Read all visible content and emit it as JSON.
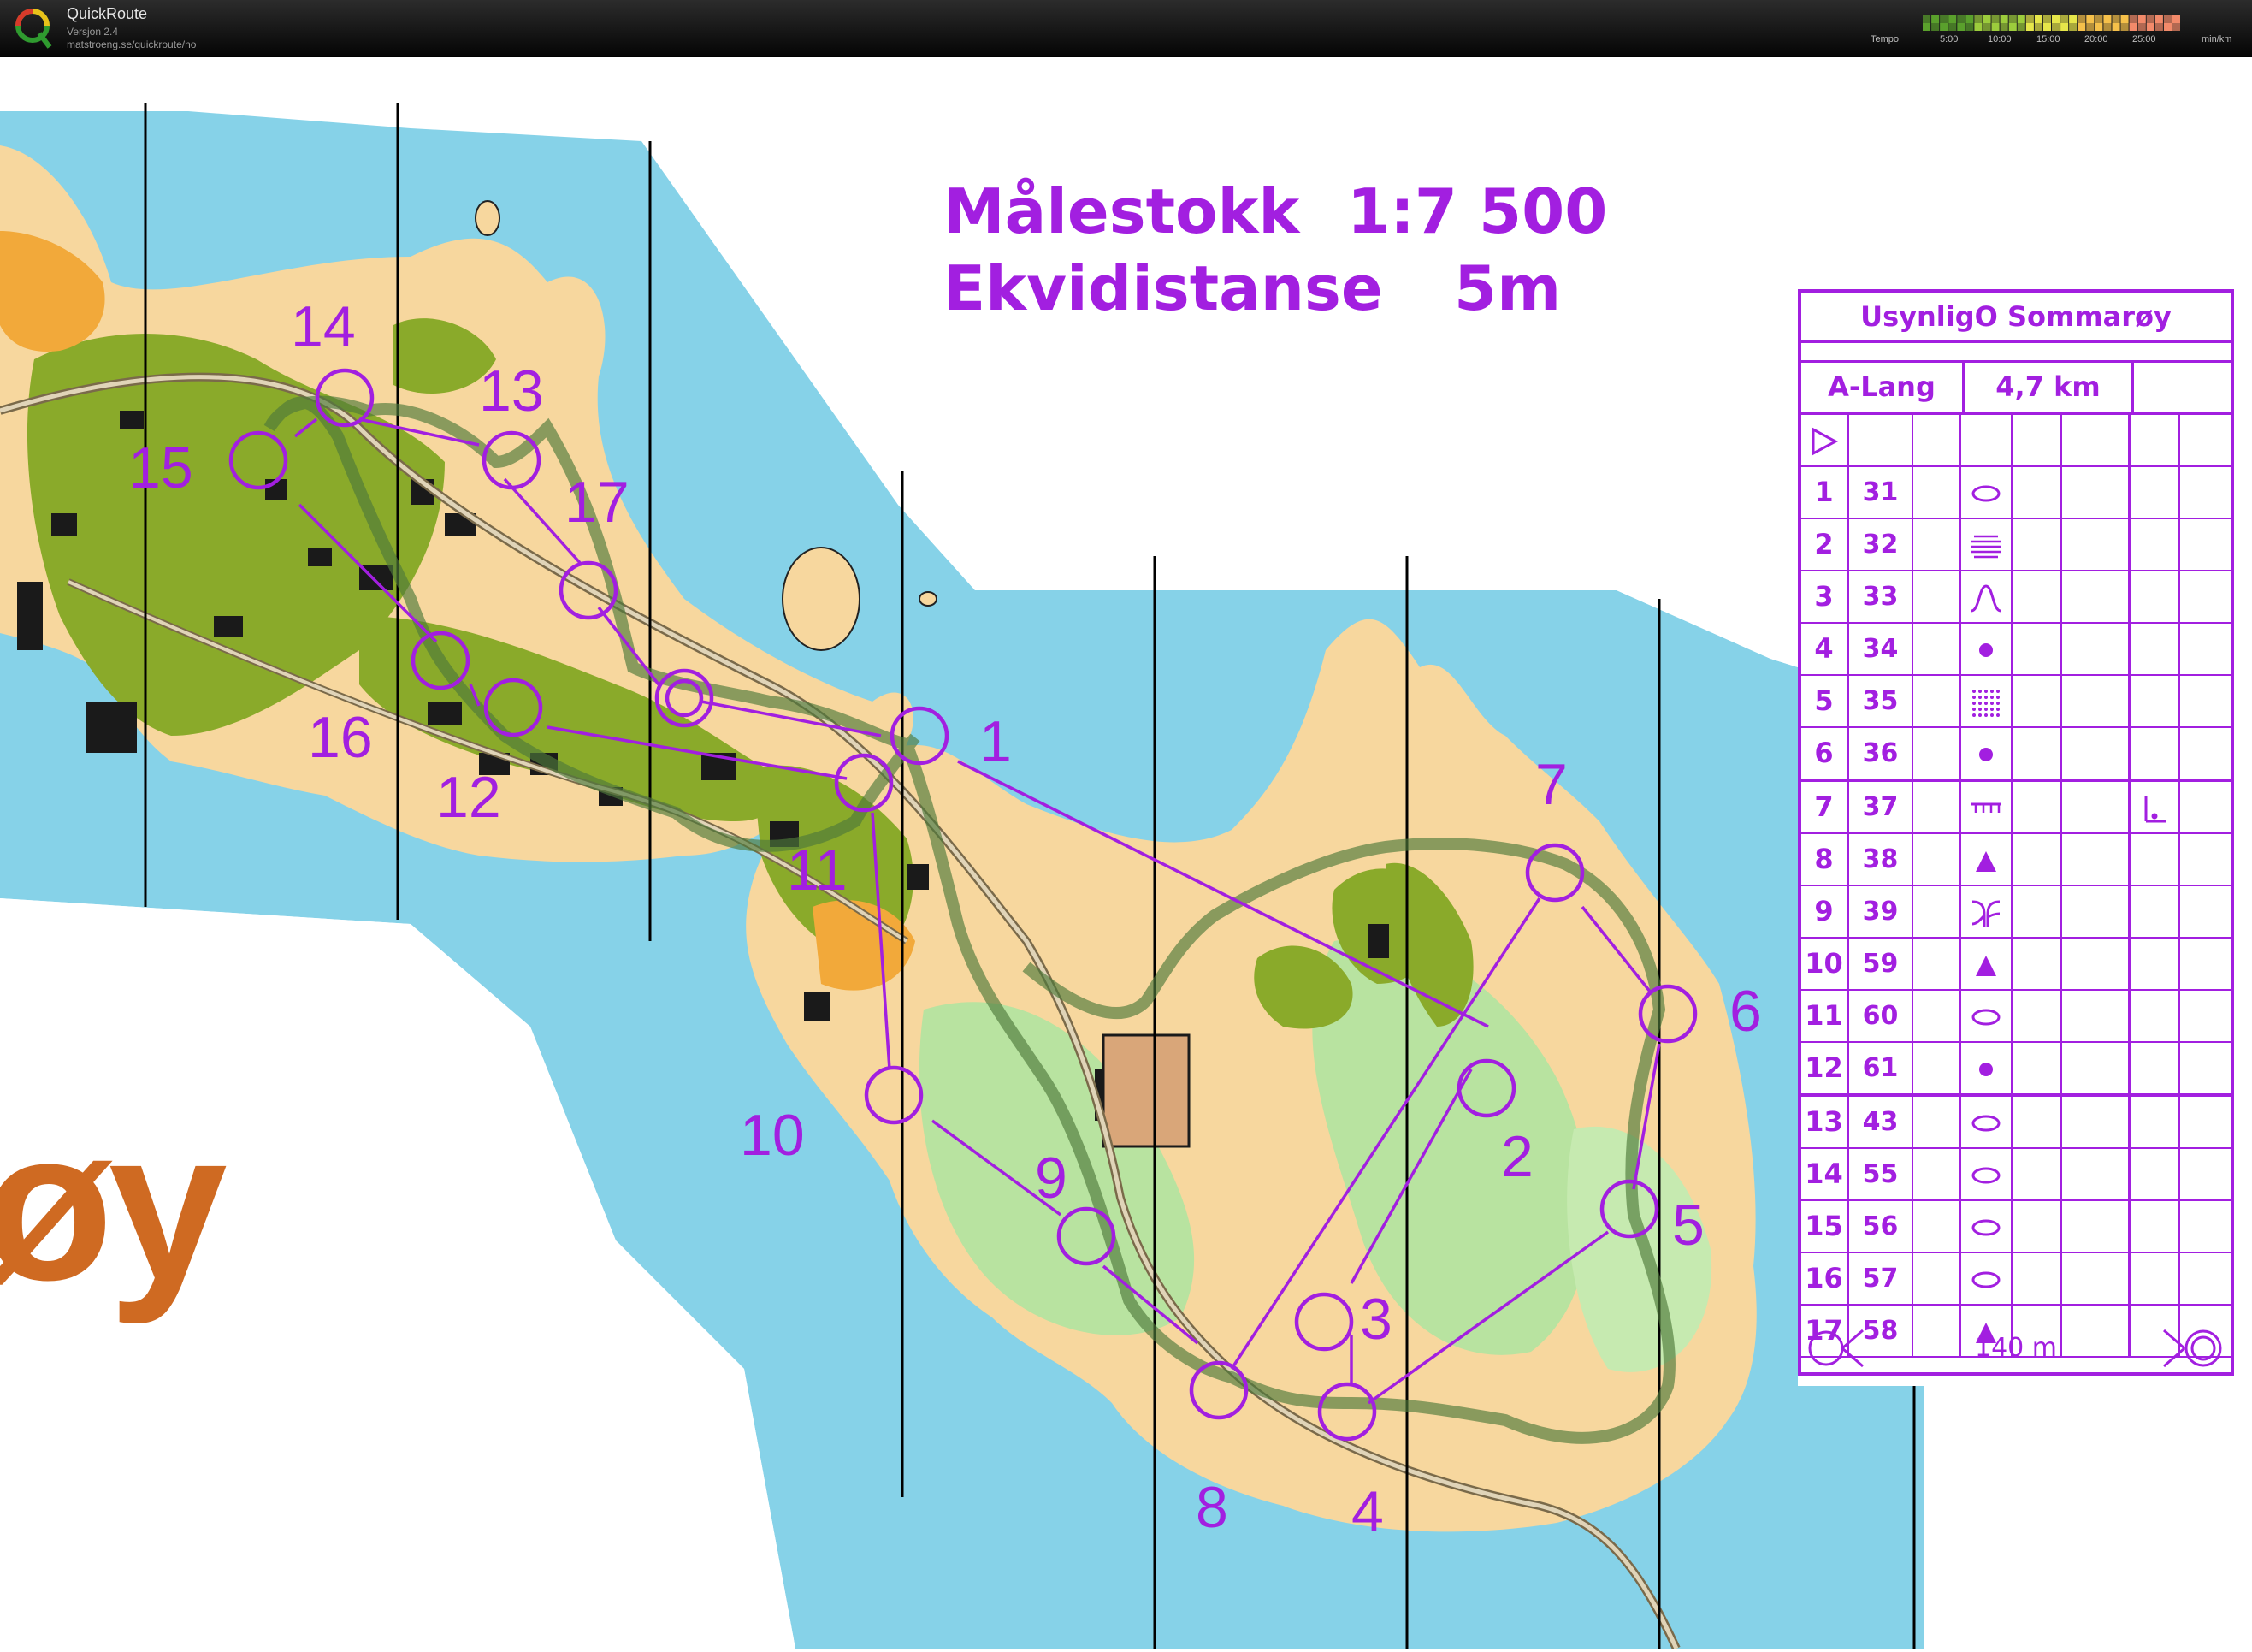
{
  "app": {
    "name": "QuickRoute",
    "version": "Versjon 2.4",
    "url": "matstroeng.se/quickroute/no"
  },
  "tempo": {
    "label": "Tempo",
    "ticks": [
      "5:00",
      "10:00",
      "15:00",
      "20:00",
      "25:00"
    ],
    "unit": "min/km",
    "colors": [
      "#5aa02c",
      "#9ccc3c",
      "#e6e64a",
      "#f5c04a",
      "#f28a6a"
    ]
  },
  "map": {
    "scale_label": "Målestokk",
    "scale_value": "1:7 500",
    "equidistance_label": "Ekvidistanse",
    "equidistance_value": "5m",
    "place_text": "øy",
    "colors": {
      "water": "#86d2e8",
      "open_land": "#f7d79e",
      "forest_green": "#9fd68a",
      "settlement": "#8aaa2a",
      "course": "#a21fe0",
      "route": "#4f7a3a",
      "place_text": "#cf6a22"
    },
    "control_labels": [
      "1",
      "2",
      "3",
      "4",
      "5",
      "6",
      "7",
      "8",
      "9",
      "10",
      "11",
      "12",
      "13",
      "14",
      "15",
      "16",
      "17"
    ]
  },
  "card": {
    "title": "UsynligO Sommarøy",
    "course": "A-Lang",
    "length": "4,7 km",
    "start_symbol": "start-triangle-icon",
    "rows": [
      {
        "num": "1",
        "code": "31",
        "feature": "knoll-oval-icon"
      },
      {
        "num": "2",
        "code": "32",
        "feature": "contour-lines-icon"
      },
      {
        "num": "3",
        "code": "33",
        "feature": "hill-icon"
      },
      {
        "num": "4",
        "code": "34",
        "feature": "boulder-dot-icon"
      },
      {
        "num": "5",
        "code": "35",
        "feature": "stony-ground-icon"
      },
      {
        "num": "6",
        "code": "36",
        "feature": "boulder-dot-icon"
      },
      {
        "num": "7",
        "code": "37",
        "feature": "fence-icon",
        "extra": "foot-corner-icon"
      },
      {
        "num": "8",
        "code": "38",
        "feature": "triangle-icon"
      },
      {
        "num": "9",
        "code": "39",
        "feature": "reentrant-icon"
      },
      {
        "num": "10",
        "code": "59",
        "feature": "triangle-icon"
      },
      {
        "num": "11",
        "code": "60",
        "feature": "knoll-oval-icon"
      },
      {
        "num": "12",
        "code": "61",
        "feature": "boulder-dot-icon"
      },
      {
        "num": "13",
        "code": "43",
        "feature": "knoll-oval-icon"
      },
      {
        "num": "14",
        "code": "55",
        "feature": "knoll-oval-icon"
      },
      {
        "num": "15",
        "code": "56",
        "feature": "knoll-oval-icon"
      },
      {
        "num": "16",
        "code": "57",
        "feature": "knoll-oval-icon"
      },
      {
        "num": "17",
        "code": "58",
        "feature": "triangle-icon"
      }
    ],
    "finish_text": "140 m"
  }
}
